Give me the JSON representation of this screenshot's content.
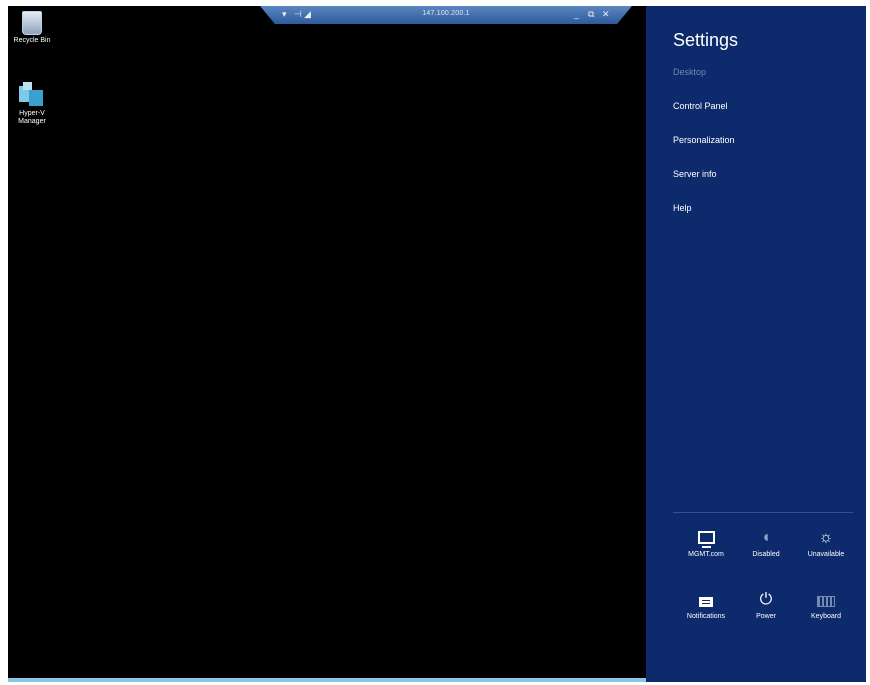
{
  "rdp_bar": {
    "address": "147.100.200.1",
    "pin_icon": "pin-icon",
    "signal_icon": "connection-signal-icon",
    "minimize_icon": "minimize-icon",
    "restore_icon": "restore-icon",
    "close_icon": "close-icon",
    "color": "#3d6aa8"
  },
  "desktop": {
    "background_color": "#000000",
    "icons": [
      {
        "label": "Recycle Bin",
        "icon": "recycle-bin-icon"
      },
      {
        "label": "Hyper-V Manager",
        "icon": "hyper-v-manager-icon"
      }
    ]
  },
  "settings": {
    "title": "Settings",
    "background_color": "#0d2a6c",
    "links": [
      {
        "label": "Desktop",
        "enabled": false
      },
      {
        "label": "Control Panel",
        "enabled": true
      },
      {
        "label": "Personalization",
        "enabled": true
      },
      {
        "label": "Server info",
        "enabled": true
      },
      {
        "label": "Help",
        "enabled": true
      }
    ],
    "tiles": [
      {
        "label": "MGMT.com",
        "icon": "network-icon"
      },
      {
        "label": "Disabled",
        "icon": "volume-icon"
      },
      {
        "label": "Unavailable",
        "icon": "brightness-icon"
      },
      {
        "label": "Notifications",
        "icon": "notifications-icon"
      },
      {
        "label": "Power",
        "icon": "power-icon"
      },
      {
        "label": "Keyboard",
        "icon": "keyboard-icon"
      }
    ]
  },
  "taskbar": {
    "color": "#8fc6e8"
  }
}
